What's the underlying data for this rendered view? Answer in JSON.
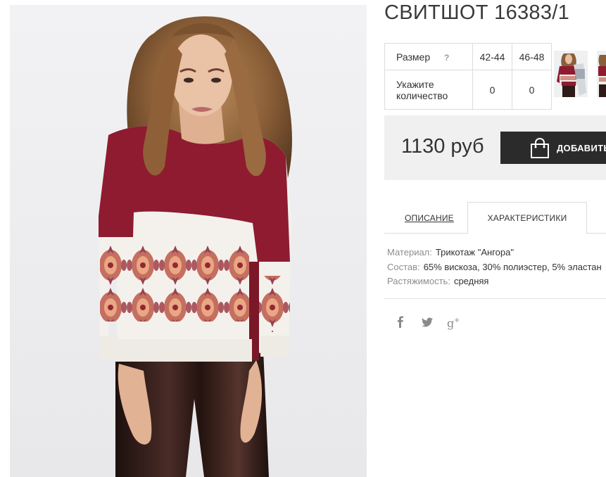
{
  "product": {
    "title": "СВИТШОТ 16383/1"
  },
  "size_table": {
    "size_label": "Размер",
    "help_mark": "?",
    "sizes": [
      "42-44",
      "46-48"
    ],
    "quantity_label": "Укажите количество",
    "quantities": [
      "0",
      "0"
    ]
  },
  "purchase": {
    "price": "1130 руб",
    "add_button_label": "ДОБАВИТЬ"
  },
  "tabs": {
    "description": "ОПИСАНИЕ",
    "characteristics": "ХАРАКТЕРИСТИКИ",
    "active": "characteristics"
  },
  "specs": [
    {
      "key": "Материал:",
      "value": "Трикотаж \"Ангора\""
    },
    {
      "key": "Состав:",
      "value": "65% вискоза, 30% полиэстер, 5% эластан"
    },
    {
      "key": "Растяжимость:",
      "value": "средняя"
    }
  ],
  "share": {
    "icons": [
      "facebook-icon",
      "twitter-icon",
      "google-plus-icon"
    ]
  },
  "colors": {
    "button_bg": "#2b2b2b",
    "buybox_bg": "#f0f0f0",
    "sweater_burgundy": "#8e1b30",
    "sweater_white": "#f4f1ec",
    "leggings": "#2e1a17"
  }
}
